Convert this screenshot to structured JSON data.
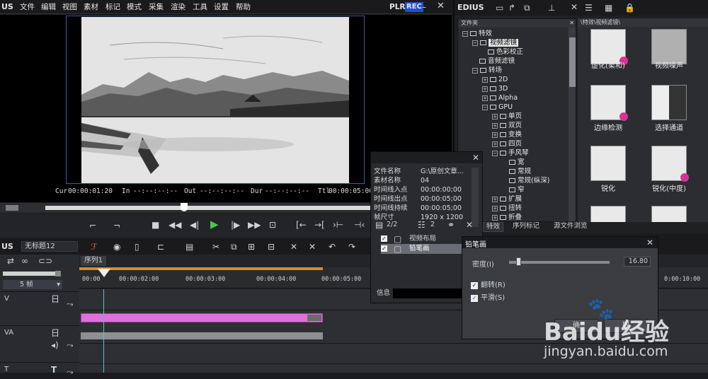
{
  "menu": {
    "logo": "US",
    "items": [
      "文件",
      "编辑",
      "视图",
      "素材",
      "标记",
      "模式",
      "采集",
      "渲染",
      "工具",
      "设置",
      "帮助"
    ],
    "plr": "PLR",
    "rec": "REC"
  },
  "preview": {
    "cur_label": "Cur",
    "cur": "00:00:01:20",
    "in_label": "In",
    "in": "--:--:--:--",
    "out_label": "Out",
    "out": "--:--:--:--",
    "dur_label": "Dur",
    "dur": "--:--:--:--",
    "ttl_label": "Ttl",
    "ttl": "00:00:05:00"
  },
  "right": {
    "logo": "EDIUS",
    "tree_header": "文件夹",
    "grid_header": "\\特效\\视频滤镜\\",
    "tree": [
      "特效",
      "视频滤镜",
      "色彩校正",
      "音频滤镜",
      "转场",
      "2D",
      "3D",
      "Alpha",
      "GPU",
      "单页",
      "双页",
      "变换",
      "四页",
      "手风琴",
      "宽",
      "常规",
      "常规(纵深)",
      "窄",
      "扩展",
      "扭转",
      "折叠"
    ],
    "tabs": [
      "特效",
      "序列标记",
      "源文件浏览"
    ],
    "effects": [
      "虚化(柔和)",
      "视频噪声",
      "边缘检测",
      "选择通道",
      "锐化",
      "锐化(中度)"
    ]
  },
  "info": {
    "rows": [
      {
        "k": "文件名称",
        "v": "G:\\原创文章..."
      },
      {
        "k": "素材名称",
        "v": "04"
      },
      {
        "k": "时间线入点",
        "v": "00:00:00;00"
      },
      {
        "k": "时间线出点",
        "v": "00:00:05;00"
      },
      {
        "k": "时间线持续",
        "v": "00:00:05;00"
      },
      {
        "k": "帧尺寸",
        "v": "1920 x 1200"
      }
    ],
    "count1": "2/2",
    "count2": "2",
    "items": [
      "视频布局",
      "铅笔画"
    ],
    "footer": "信息"
  },
  "dialog": {
    "title": "铅笔画",
    "density_label": "密度(I)",
    "density": "16.80",
    "invert": "翻转(R)",
    "smooth": "平滑(S)",
    "ok": "确",
    "cancel": "取"
  },
  "timeline": {
    "logo": "US",
    "project": "无标题12",
    "tab": "序列1",
    "frames": "5 帧",
    "ticks": [
      "00:00",
      "00:00:02:00",
      "00:00:03:00",
      "00:00:04:00",
      "00:00:05:00",
      "0:00:10:00"
    ],
    "tracks": [
      "V",
      "VA",
      "T"
    ]
  },
  "watermark": {
    "main": "Baidu经验",
    "url": "jingyan.baidu.com"
  },
  "colors": {
    "accent": "#3a5aa0",
    "clip": "#e070d8",
    "play": "#4fc54f",
    "rec": "#1f4fd6"
  }
}
